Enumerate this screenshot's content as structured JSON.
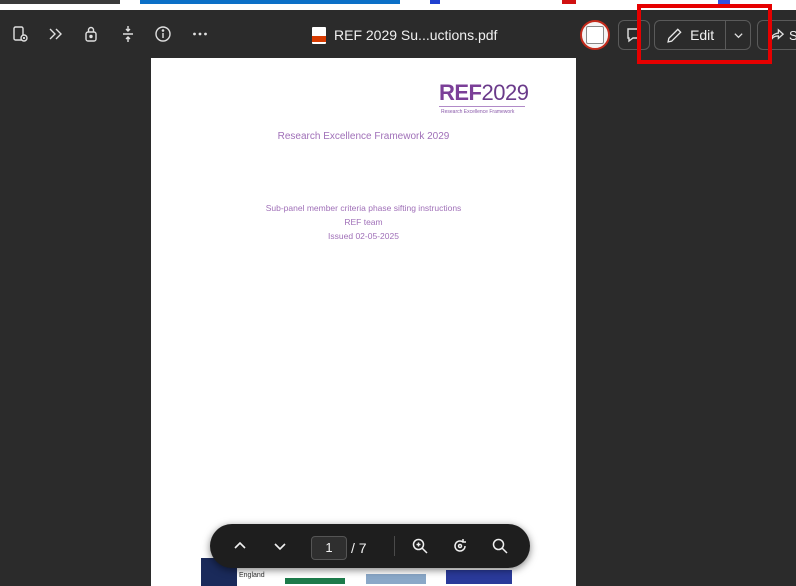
{
  "toolbar": {
    "document_title": "REF 2029 Su...uctions.pdf",
    "edit_label": "Edit",
    "share_label": "S",
    "icons": [
      "sidebar-toggle-icon",
      "read-aloud-icon",
      "lock-icon",
      "fit-page-icon",
      "info-icon",
      "more-icon",
      "pdf-file-icon",
      "avatar",
      "comment-icon",
      "pen-icon",
      "chevron-down-icon",
      "share-icon"
    ]
  },
  "page": {
    "logo_ref": "REF",
    "logo_year": "2029",
    "logo_subtitle": "Research Excellence Framework",
    "heading": "Research Excellence Framework 2029",
    "line1": "Sub-panel member criteria phase sifting instructions",
    "line2": "REF team",
    "line3": "Issued 02-05-2025",
    "footer_logo_england": "England"
  },
  "nav": {
    "current_page": "1",
    "total_pages": "/ 7"
  },
  "colors": {
    "background": "#2b2b2b",
    "accent_purple": "#7b3f98",
    "highlight_red": "#e60000"
  }
}
